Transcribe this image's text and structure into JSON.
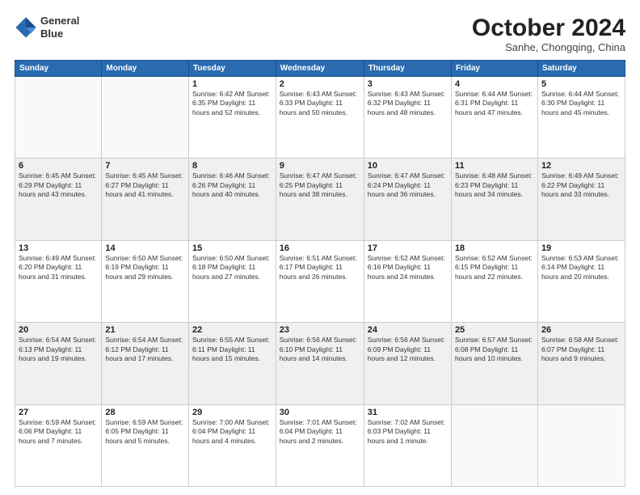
{
  "header": {
    "logo_line1": "General",
    "logo_line2": "Blue",
    "month": "October 2024",
    "location": "Sanhe, Chongqing, China"
  },
  "weekdays": [
    "Sunday",
    "Monday",
    "Tuesday",
    "Wednesday",
    "Thursday",
    "Friday",
    "Saturday"
  ],
  "weeks": [
    [
      {
        "day": "",
        "info": ""
      },
      {
        "day": "",
        "info": ""
      },
      {
        "day": "1",
        "info": "Sunrise: 6:42 AM\nSunset: 6:35 PM\nDaylight: 11 hours and 52 minutes."
      },
      {
        "day": "2",
        "info": "Sunrise: 6:43 AM\nSunset: 6:33 PM\nDaylight: 11 hours and 50 minutes."
      },
      {
        "day": "3",
        "info": "Sunrise: 6:43 AM\nSunset: 6:32 PM\nDaylight: 11 hours and 48 minutes."
      },
      {
        "day": "4",
        "info": "Sunrise: 6:44 AM\nSunset: 6:31 PM\nDaylight: 11 hours and 47 minutes."
      },
      {
        "day": "5",
        "info": "Sunrise: 6:44 AM\nSunset: 6:30 PM\nDaylight: 11 hours and 45 minutes."
      }
    ],
    [
      {
        "day": "6",
        "info": "Sunrise: 6:45 AM\nSunset: 6:29 PM\nDaylight: 11 hours and 43 minutes."
      },
      {
        "day": "7",
        "info": "Sunrise: 6:45 AM\nSunset: 6:27 PM\nDaylight: 11 hours and 41 minutes."
      },
      {
        "day": "8",
        "info": "Sunrise: 6:46 AM\nSunset: 6:26 PM\nDaylight: 11 hours and 40 minutes."
      },
      {
        "day": "9",
        "info": "Sunrise: 6:47 AM\nSunset: 6:25 PM\nDaylight: 11 hours and 38 minutes."
      },
      {
        "day": "10",
        "info": "Sunrise: 6:47 AM\nSunset: 6:24 PM\nDaylight: 11 hours and 36 minutes."
      },
      {
        "day": "11",
        "info": "Sunrise: 6:48 AM\nSunset: 6:23 PM\nDaylight: 11 hours and 34 minutes."
      },
      {
        "day": "12",
        "info": "Sunrise: 6:49 AM\nSunset: 6:22 PM\nDaylight: 11 hours and 33 minutes."
      }
    ],
    [
      {
        "day": "13",
        "info": "Sunrise: 6:49 AM\nSunset: 6:20 PM\nDaylight: 11 hours and 31 minutes."
      },
      {
        "day": "14",
        "info": "Sunrise: 6:50 AM\nSunset: 6:19 PM\nDaylight: 11 hours and 29 minutes."
      },
      {
        "day": "15",
        "info": "Sunrise: 6:50 AM\nSunset: 6:18 PM\nDaylight: 11 hours and 27 minutes."
      },
      {
        "day": "16",
        "info": "Sunrise: 6:51 AM\nSunset: 6:17 PM\nDaylight: 11 hours and 26 minutes."
      },
      {
        "day": "17",
        "info": "Sunrise: 6:52 AM\nSunset: 6:16 PM\nDaylight: 11 hours and 24 minutes."
      },
      {
        "day": "18",
        "info": "Sunrise: 6:52 AM\nSunset: 6:15 PM\nDaylight: 11 hours and 22 minutes."
      },
      {
        "day": "19",
        "info": "Sunrise: 6:53 AM\nSunset: 6:14 PM\nDaylight: 11 hours and 20 minutes."
      }
    ],
    [
      {
        "day": "20",
        "info": "Sunrise: 6:54 AM\nSunset: 6:13 PM\nDaylight: 11 hours and 19 minutes."
      },
      {
        "day": "21",
        "info": "Sunrise: 6:54 AM\nSunset: 6:12 PM\nDaylight: 11 hours and 17 minutes."
      },
      {
        "day": "22",
        "info": "Sunrise: 6:55 AM\nSunset: 6:11 PM\nDaylight: 11 hours and 15 minutes."
      },
      {
        "day": "23",
        "info": "Sunrise: 6:56 AM\nSunset: 6:10 PM\nDaylight: 11 hours and 14 minutes."
      },
      {
        "day": "24",
        "info": "Sunrise: 6:56 AM\nSunset: 6:09 PM\nDaylight: 11 hours and 12 minutes."
      },
      {
        "day": "25",
        "info": "Sunrise: 6:57 AM\nSunset: 6:08 PM\nDaylight: 11 hours and 10 minutes."
      },
      {
        "day": "26",
        "info": "Sunrise: 6:58 AM\nSunset: 6:07 PM\nDaylight: 11 hours and 9 minutes."
      }
    ],
    [
      {
        "day": "27",
        "info": "Sunrise: 6:59 AM\nSunset: 6:06 PM\nDaylight: 11 hours and 7 minutes."
      },
      {
        "day": "28",
        "info": "Sunrise: 6:59 AM\nSunset: 6:05 PM\nDaylight: 11 hours and 5 minutes."
      },
      {
        "day": "29",
        "info": "Sunrise: 7:00 AM\nSunset: 6:04 PM\nDaylight: 11 hours and 4 minutes."
      },
      {
        "day": "30",
        "info": "Sunrise: 7:01 AM\nSunset: 6:04 PM\nDaylight: 11 hours and 2 minutes."
      },
      {
        "day": "31",
        "info": "Sunrise: 7:02 AM\nSunset: 6:03 PM\nDaylight: 11 hours and 1 minute."
      },
      {
        "day": "",
        "info": ""
      },
      {
        "day": "",
        "info": ""
      }
    ]
  ]
}
